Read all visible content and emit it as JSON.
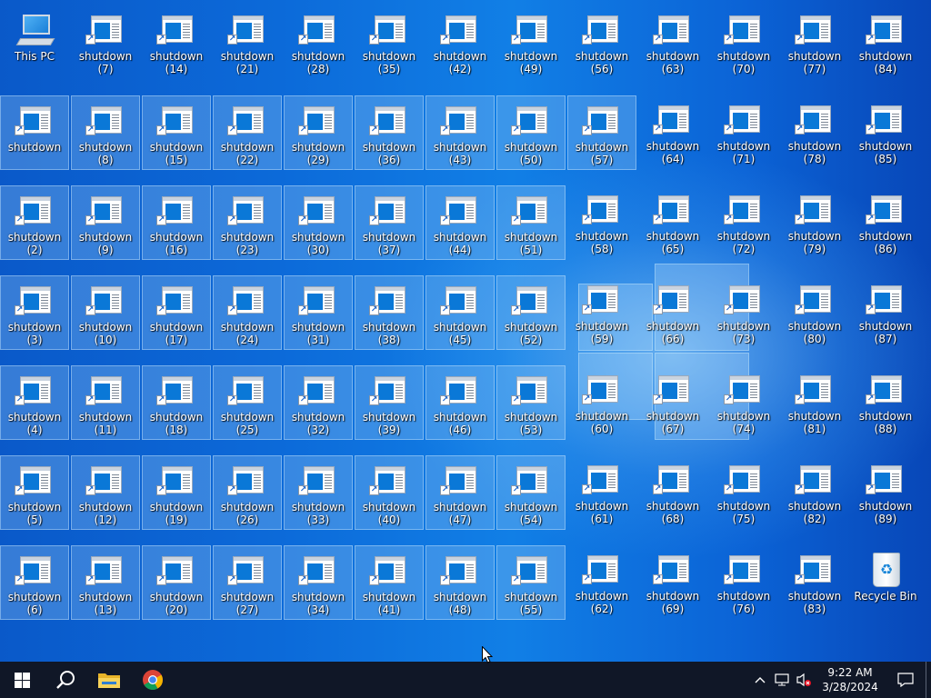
{
  "desktop": {
    "this_pc": "This PC",
    "recycle_bin": "Recycle Bin",
    "shortcuts": [
      {
        "label": "shutdown (7)",
        "col": 1,
        "row": 0,
        "sel": false
      },
      {
        "label": "shutdown\n(14)",
        "col": 2,
        "row": 0,
        "sel": false
      },
      {
        "label": "shutdown\n(21)",
        "col": 3,
        "row": 0,
        "sel": false
      },
      {
        "label": "shutdown\n(28)",
        "col": 4,
        "row": 0,
        "sel": false
      },
      {
        "label": "shutdown\n(35)",
        "col": 5,
        "row": 0,
        "sel": false
      },
      {
        "label": "shutdown\n(42)",
        "col": 6,
        "row": 0,
        "sel": false
      },
      {
        "label": "shutdown\n(49)",
        "col": 7,
        "row": 0,
        "sel": false
      },
      {
        "label": "shutdown\n(56)",
        "col": 8,
        "row": 0,
        "sel": false
      },
      {
        "label": "shutdown\n(63)",
        "col": 9,
        "row": 0,
        "sel": false
      },
      {
        "label": "shutdown\n(70)",
        "col": 10,
        "row": 0,
        "sel": false
      },
      {
        "label": "shutdown\n(77)",
        "col": 11,
        "row": 0,
        "sel": false
      },
      {
        "label": "shutdown\n(84)",
        "col": 12,
        "row": 0,
        "sel": false
      },
      {
        "label": "shutdown",
        "col": 0,
        "row": 1,
        "sel": true
      },
      {
        "label": "shutdown (8)",
        "col": 1,
        "row": 1,
        "sel": true
      },
      {
        "label": "shutdown\n(15)",
        "col": 2,
        "row": 1,
        "sel": true
      },
      {
        "label": "shutdown\n(22)",
        "col": 3,
        "row": 1,
        "sel": true
      },
      {
        "label": "shutdown\n(29)",
        "col": 4,
        "row": 1,
        "sel": true
      },
      {
        "label": "shutdown\n(36)",
        "col": 5,
        "row": 1,
        "sel": true
      },
      {
        "label": "shutdown\n(43)",
        "col": 6,
        "row": 1,
        "sel": true
      },
      {
        "label": "shutdown\n(50)",
        "col": 7,
        "row": 1,
        "sel": true
      },
      {
        "label": "shutdown\n(57)",
        "col": 8,
        "row": 1,
        "sel": true
      },
      {
        "label": "shutdown\n(64)",
        "col": 9,
        "row": 1,
        "sel": false
      },
      {
        "label": "shutdown\n(71)",
        "col": 10,
        "row": 1,
        "sel": false
      },
      {
        "label": "shutdown\n(78)",
        "col": 11,
        "row": 1,
        "sel": false
      },
      {
        "label": "shutdown\n(85)",
        "col": 12,
        "row": 1,
        "sel": false
      },
      {
        "label": "shutdown (2)",
        "col": 0,
        "row": 2,
        "sel": true
      },
      {
        "label": "shutdown (9)",
        "col": 1,
        "row": 2,
        "sel": true
      },
      {
        "label": "shutdown\n(16)",
        "col": 2,
        "row": 2,
        "sel": true
      },
      {
        "label": "shutdown\n(23)",
        "col": 3,
        "row": 2,
        "sel": true
      },
      {
        "label": "shutdown\n(30)",
        "col": 4,
        "row": 2,
        "sel": true
      },
      {
        "label": "shutdown\n(37)",
        "col": 5,
        "row": 2,
        "sel": true
      },
      {
        "label": "shutdown\n(44)",
        "col": 6,
        "row": 2,
        "sel": true
      },
      {
        "label": "shutdown\n(51)",
        "col": 7,
        "row": 2,
        "sel": true
      },
      {
        "label": "shutdown\n(58)",
        "col": 8,
        "row": 2,
        "sel": false
      },
      {
        "label": "shutdown\n(65)",
        "col": 9,
        "row": 2,
        "sel": false
      },
      {
        "label": "shutdown\n(72)",
        "col": 10,
        "row": 2,
        "sel": false
      },
      {
        "label": "shutdown\n(79)",
        "col": 11,
        "row": 2,
        "sel": false
      },
      {
        "label": "shutdown\n(86)",
        "col": 12,
        "row": 2,
        "sel": false
      },
      {
        "label": "shutdown (3)",
        "col": 0,
        "row": 3,
        "sel": true
      },
      {
        "label": "shutdown\n(10)",
        "col": 1,
        "row": 3,
        "sel": true
      },
      {
        "label": "shutdown\n(17)",
        "col": 2,
        "row": 3,
        "sel": true
      },
      {
        "label": "shutdown\n(24)",
        "col": 3,
        "row": 3,
        "sel": true
      },
      {
        "label": "shutdown\n(31)",
        "col": 4,
        "row": 3,
        "sel": true
      },
      {
        "label": "shutdown\n(38)",
        "col": 5,
        "row": 3,
        "sel": true
      },
      {
        "label": "shutdown\n(45)",
        "col": 6,
        "row": 3,
        "sel": true
      },
      {
        "label": "shutdown\n(52)",
        "col": 7,
        "row": 3,
        "sel": true
      },
      {
        "label": "shutdown\n(59)",
        "col": 8,
        "row": 3,
        "sel": false
      },
      {
        "label": "shutdown\n(66)",
        "col": 9,
        "row": 3,
        "sel": false
      },
      {
        "label": "shutdown\n(73)",
        "col": 10,
        "row": 3,
        "sel": false
      },
      {
        "label": "shutdown\n(80)",
        "col": 11,
        "row": 3,
        "sel": false
      },
      {
        "label": "shutdown\n(87)",
        "col": 12,
        "row": 3,
        "sel": false
      },
      {
        "label": "shutdown (4)",
        "col": 0,
        "row": 4,
        "sel": true
      },
      {
        "label": "shutdown\n(11)",
        "col": 1,
        "row": 4,
        "sel": true
      },
      {
        "label": "shutdown\n(18)",
        "col": 2,
        "row": 4,
        "sel": true
      },
      {
        "label": "shutdown\n(25)",
        "col": 3,
        "row": 4,
        "sel": true
      },
      {
        "label": "shutdown\n(32)",
        "col": 4,
        "row": 4,
        "sel": true
      },
      {
        "label": "shutdown\n(39)",
        "col": 5,
        "row": 4,
        "sel": true
      },
      {
        "label": "shutdown\n(46)",
        "col": 6,
        "row": 4,
        "sel": true
      },
      {
        "label": "shutdown\n(53)",
        "col": 7,
        "row": 4,
        "sel": true
      },
      {
        "label": "shutdown\n(60)",
        "col": 8,
        "row": 4,
        "sel": false
      },
      {
        "label": "shutdown\n(67)",
        "col": 9,
        "row": 4,
        "sel": false
      },
      {
        "label": "shutdown\n(74)",
        "col": 10,
        "row": 4,
        "sel": false
      },
      {
        "label": "shutdown\n(81)",
        "col": 11,
        "row": 4,
        "sel": false
      },
      {
        "label": "shutdown\n(88)",
        "col": 12,
        "row": 4,
        "sel": false
      },
      {
        "label": "shutdown (5)",
        "col": 0,
        "row": 5,
        "sel": true
      },
      {
        "label": "shutdown\n(12)",
        "col": 1,
        "row": 5,
        "sel": true
      },
      {
        "label": "shutdown\n(19)",
        "col": 2,
        "row": 5,
        "sel": true
      },
      {
        "label": "shutdown\n(26)",
        "col": 3,
        "row": 5,
        "sel": true
      },
      {
        "label": "shutdown\n(33)",
        "col": 4,
        "row": 5,
        "sel": true
      },
      {
        "label": "shutdown\n(40)",
        "col": 5,
        "row": 5,
        "sel": true
      },
      {
        "label": "shutdown\n(47)",
        "col": 6,
        "row": 5,
        "sel": true
      },
      {
        "label": "shutdown\n(54)",
        "col": 7,
        "row": 5,
        "sel": true
      },
      {
        "label": "shutdown\n(61)",
        "col": 8,
        "row": 5,
        "sel": false
      },
      {
        "label": "shutdown\n(68)",
        "col": 9,
        "row": 5,
        "sel": false
      },
      {
        "label": "shutdown\n(75)",
        "col": 10,
        "row": 5,
        "sel": false
      },
      {
        "label": "shutdown\n(82)",
        "col": 11,
        "row": 5,
        "sel": false
      },
      {
        "label": "shutdown\n(89)",
        "col": 12,
        "row": 5,
        "sel": false
      },
      {
        "label": "shutdown (6)",
        "col": 0,
        "row": 6,
        "sel": true
      },
      {
        "label": "shutdown\n(13)",
        "col": 1,
        "row": 6,
        "sel": true
      },
      {
        "label": "shutdown\n(20)",
        "col": 2,
        "row": 6,
        "sel": true
      },
      {
        "label": "shutdown\n(27)",
        "col": 3,
        "row": 6,
        "sel": true
      },
      {
        "label": "shutdown\n(34)",
        "col": 4,
        "row": 6,
        "sel": true
      },
      {
        "label": "shutdown\n(41)",
        "col": 5,
        "row": 6,
        "sel": true
      },
      {
        "label": "shutdown\n(48)",
        "col": 6,
        "row": 6,
        "sel": true
      },
      {
        "label": "shutdown\n(55)",
        "col": 7,
        "row": 6,
        "sel": true
      },
      {
        "label": "shutdown\n(62)",
        "col": 8,
        "row": 6,
        "sel": false
      },
      {
        "label": "shutdown\n(69)",
        "col": 9,
        "row": 6,
        "sel": false
      },
      {
        "label": "shutdown\n(76)",
        "col": 10,
        "row": 6,
        "sel": false
      },
      {
        "label": "shutdown\n(83)",
        "col": 11,
        "row": 6,
        "sel": false
      }
    ]
  },
  "taskbar": {
    "pinned": [
      {
        "name": "start-button",
        "icon": "windows-logo-icon"
      },
      {
        "name": "search-button",
        "icon": "search-icon"
      },
      {
        "name": "file-explorer-button",
        "icon": "folder-icon"
      },
      {
        "name": "chrome-button",
        "icon": "chrome-icon"
      }
    ],
    "tray": {
      "icons": [
        "chevron-up-icon",
        "network-icon",
        "volume-muted-icon"
      ],
      "time": "9:22 AM",
      "date": "3/28/2024"
    }
  },
  "colors": {
    "accent": "#0a78d7",
    "taskbar": "#101727"
  }
}
